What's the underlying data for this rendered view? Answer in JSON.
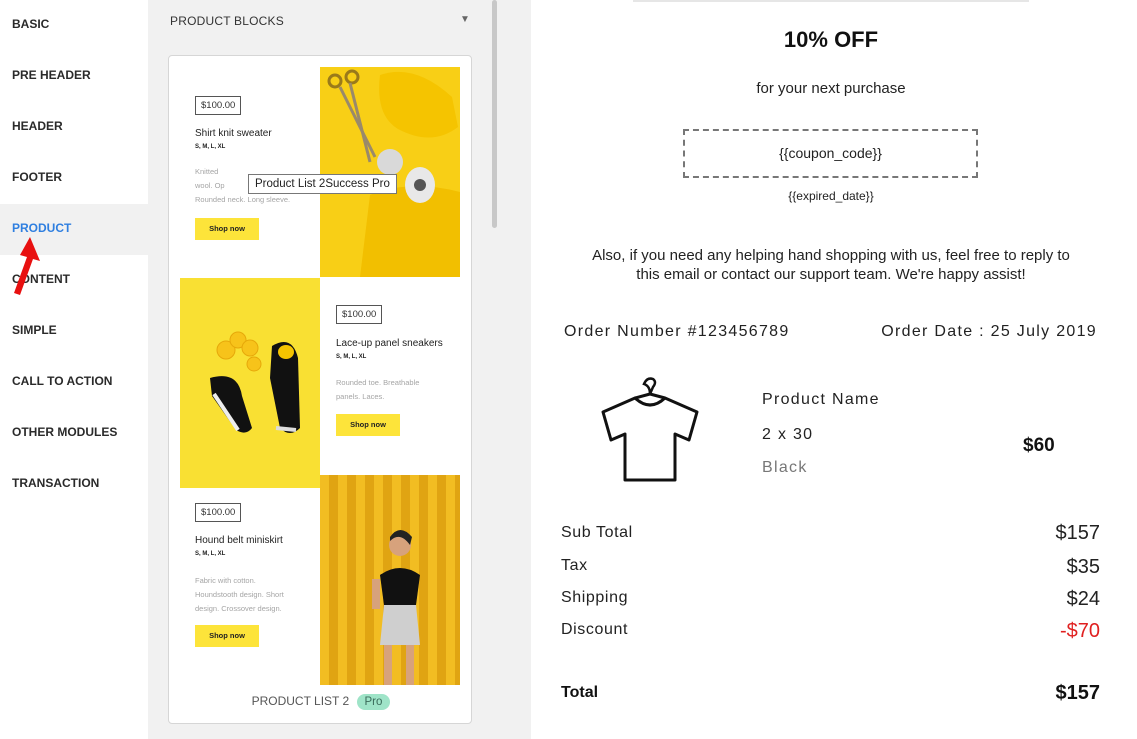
{
  "nav": {
    "items": [
      {
        "label": "BASIC"
      },
      {
        "label": "PRE HEADER"
      },
      {
        "label": "HEADER"
      },
      {
        "label": "FOOTER"
      },
      {
        "label": "PRODUCT"
      },
      {
        "label": "CONTENT"
      },
      {
        "label": "SIMPLE"
      },
      {
        "label": "CALL TO ACTION"
      },
      {
        "label": "OTHER MODULES"
      },
      {
        "label": "TRANSACTION"
      }
    ],
    "active_color": "#2f7fe0"
  },
  "blocks": {
    "header": "PRODUCT BLOCKS",
    "products": [
      {
        "price": "$100.00",
        "name": "Shirt knit sweater",
        "sizes": "S, M, L, XL",
        "desc1": "Knitted",
        "desc2": "wool. Op",
        "desc3": "Rounded neck. Long sleeve.",
        "button": "Shop now"
      },
      {
        "price": "$100.00",
        "name": "Lace-up panel sneakers",
        "sizes": "S, M, L, XL",
        "desc1": "Rounded toe. Breathable",
        "desc2": "panels. Laces.",
        "button": "Shop now"
      },
      {
        "price": "$100.00",
        "name": "Hound belt miniskirt",
        "sizes": "S, M, L, XL",
        "desc1": "Fabric with cotton.",
        "desc2": "Houndstooth design. Short",
        "desc3": "design. Crossover design.",
        "button": "Shop now"
      }
    ],
    "tooltip": "Product List 2Success Pro",
    "card_label": "PRODUCT LIST 2",
    "badge": "Pro",
    "accent_color": "#fde43a"
  },
  "email": {
    "headline": "10% OFF",
    "subline": "for your next purchase",
    "coupon": "{{coupon_code}}",
    "expiry": "{{expired_date}}",
    "message_line1": "Also, if you need any helping hand shopping with us, feel free to reply to",
    "message_line2": "this email or contact our support team. We're happy assist!",
    "order_number": "Order Number #123456789",
    "order_date": "Order Date : 25 July 2019",
    "product_name": "Product Name",
    "product_qty": "2 x 30",
    "product_color": "Black",
    "product_price": "$60",
    "summary": [
      {
        "label": "Sub Total",
        "value": "$157"
      },
      {
        "label": "Tax",
        "value": "$35"
      },
      {
        "label": "Shipping",
        "value": "$24"
      },
      {
        "label": "Discount",
        "value": "-$70"
      }
    ],
    "total_label": "Total",
    "total_value": "$157",
    "discount_color": "#e02020"
  }
}
